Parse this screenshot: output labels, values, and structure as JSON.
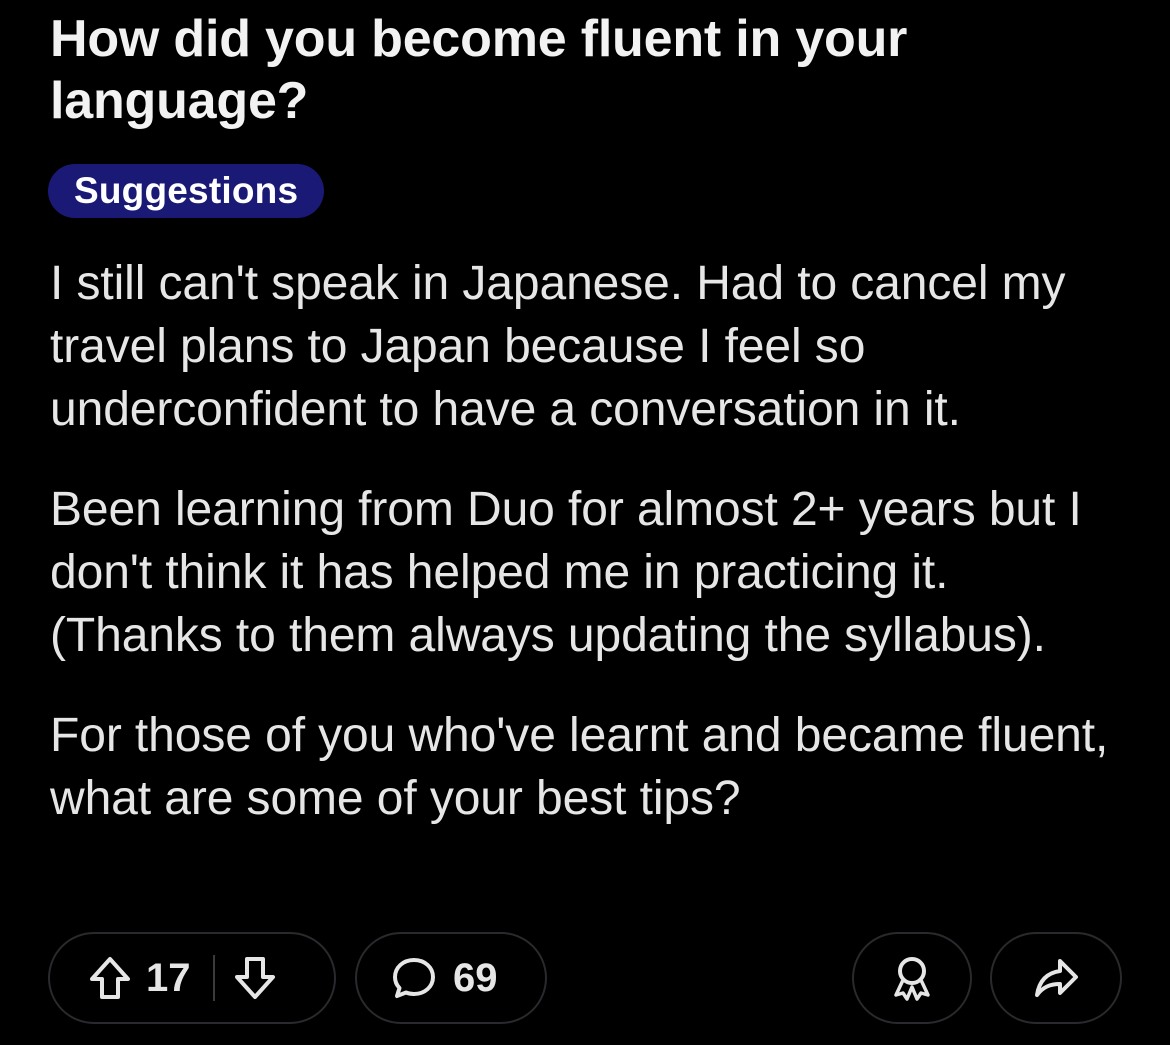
{
  "post": {
    "title": "How did you become fluent in your language?",
    "flair": "Suggestions",
    "body": [
      "I still can't speak in Japanese. Had to cancel my travel plans to Japan because I feel so underconfident to have a conversation in it.",
      "Been learning from Duo for almost 2+ years but I don't think it has helped me in practicing it. (Thanks to them always updating the syllabus).",
      "For those of you who've learnt and became fluent, what are some of your best tips?"
    ]
  },
  "actions": {
    "vote_count": "17",
    "comment_count": "69",
    "upvote_icon": "arrow-up-outline-icon",
    "downvote_icon": "arrow-down-outline-icon",
    "comment_icon": "speech-bubble-icon",
    "award_icon": "award-ribbon-icon",
    "share_icon": "share-arrow-icon"
  },
  "colors": {
    "background": "#000000",
    "text": "#e6e6e7",
    "flair_bg": "#1a1976",
    "pill_border": "#2a2a2e"
  }
}
